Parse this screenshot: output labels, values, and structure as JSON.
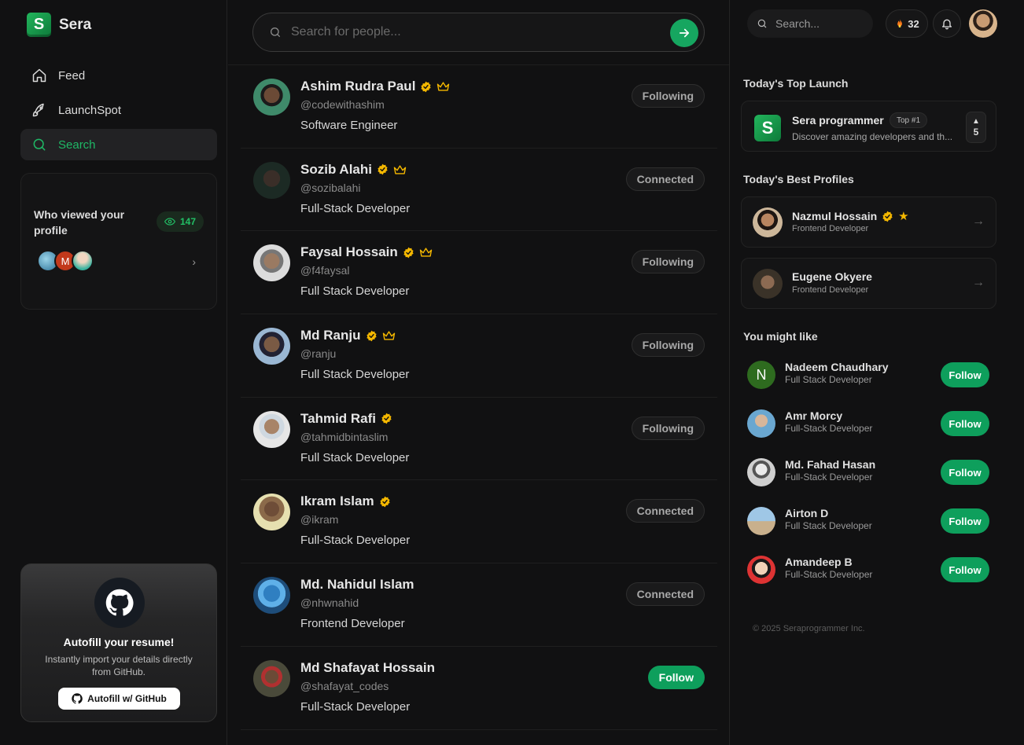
{
  "brand": {
    "name": "Sera",
    "logo_letter": "S"
  },
  "nav": [
    {
      "label": "Feed",
      "icon": "home-icon"
    },
    {
      "label": "LaunchSpot",
      "icon": "rocket-icon"
    },
    {
      "label": "Search",
      "icon": "search-icon",
      "active": true
    }
  ],
  "viewers": {
    "title": "Who viewed your profile",
    "count": "147",
    "avatars": [
      "",
      "M",
      ""
    ]
  },
  "autofill": {
    "title": "Autofill your resume!",
    "description": "Instantly import your details directly from GitHub.",
    "button": "Autofill w/ GitHub"
  },
  "search": {
    "placeholder": "Search for people..."
  },
  "people": [
    {
      "name": "Ashim Rudra Paul",
      "handle": "@codewithashim",
      "title": "Software Engineer",
      "verified": true,
      "crown": true,
      "action": "Following"
    },
    {
      "name": "Sozib Alahi",
      "handle": "@sozibalahi",
      "title": "Full-Stack Developer",
      "verified": true,
      "crown": true,
      "action": "Connected"
    },
    {
      "name": "Faysal Hossain",
      "handle": "@f4faysal",
      "title": "Full Stack Developer",
      "verified": true,
      "crown": true,
      "action": "Following"
    },
    {
      "name": "Md Ranju",
      "handle": "@ranju",
      "title": "Full Stack Developer",
      "verified": true,
      "crown": true,
      "action": "Following"
    },
    {
      "name": "Tahmid Rafi",
      "handle": "@tahmidbintaslim",
      "title": "Full Stack Developer",
      "verified": true,
      "crown": false,
      "action": "Following"
    },
    {
      "name": "Ikram Islam",
      "handle": "@ikram",
      "title": "Full-Stack Developer",
      "verified": true,
      "crown": false,
      "action": "Connected"
    },
    {
      "name": "Md. Nahidul Islam",
      "handle": "@nhwnahid",
      "title": "Frontend Developer",
      "verified": false,
      "crown": false,
      "action": "Connected"
    },
    {
      "name": "Md Shafayat Hossain",
      "handle": "@shafayat_codes",
      "title": "Full-Stack Developer",
      "verified": false,
      "crown": false,
      "action": "Follow"
    }
  ],
  "topbar": {
    "search_placeholder": "Search...",
    "streak": "32"
  },
  "top_launch": {
    "heading": "Today's Top Launch",
    "name": "Sera programmer",
    "tag": "Top #1",
    "description": "Discover amazing developers and th...",
    "votes": "5"
  },
  "best_profiles": {
    "heading": "Today's Best Profiles",
    "items": [
      {
        "name": "Nazmul Hossain",
        "role": "Frontend Developer",
        "verified": true,
        "star": true
      },
      {
        "name": "Eugene Okyere",
        "role": "Frontend Developer",
        "verified": false,
        "star": false
      }
    ]
  },
  "suggestions": {
    "heading": "You might like",
    "items": [
      {
        "name": "Nadeem Chaudhary",
        "role": "Full Stack Developer",
        "initial": "N",
        "button": "Follow"
      },
      {
        "name": "Amr Morcy",
        "role": "Full-Stack Developer",
        "initial": "",
        "button": "Follow"
      },
      {
        "name": "Md. Fahad Hasan",
        "role": "Full-Stack Developer",
        "initial": "",
        "button": "Follow"
      },
      {
        "name": "Airton D",
        "role": "Full Stack Developer",
        "initial": "",
        "button": "Follow"
      },
      {
        "name": "Amandeep B",
        "role": "Full-Stack Developer",
        "initial": "",
        "button": "Follow"
      }
    ]
  },
  "footer": {
    "copyright": "© 2025 Seraprogrammer Inc."
  },
  "colors": {
    "accent": "#0e9f5c",
    "active_nav": "#1fb866",
    "verified": "#f5b800",
    "background": "#111112"
  }
}
